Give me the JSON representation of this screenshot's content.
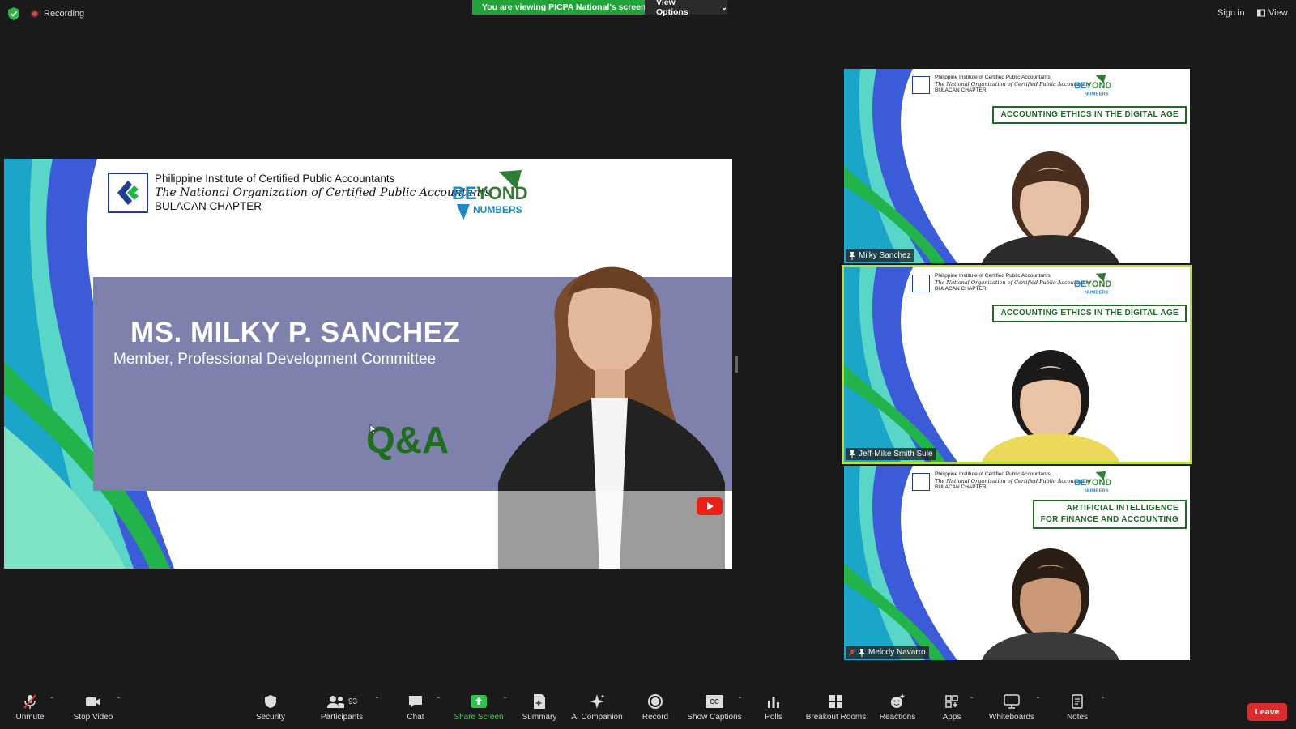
{
  "topbar": {
    "recording_label": "Recording",
    "viewing_banner": "You are viewing PICPA National's screen",
    "view_options_label": "View Options",
    "sign_in_label": "Sign in",
    "view_label": "View"
  },
  "slide": {
    "org_line1": "Philippine Institute of Certified Public Accountants",
    "org_line2": "The National Organization of Certified Public Accountants",
    "org_line3": "BULACAN CHAPTER",
    "speaker_name": "MS. MILKY P. SANCHEZ",
    "speaker_role": "Member, Professional Development Committee",
    "qa_label": "Q&A"
  },
  "tiles": [
    {
      "name": "Milky Sanchez",
      "title_lines": [
        "ACCOUNTING ETHICS IN THE DIGITAL AGE"
      ],
      "org_lines": [
        "Philippine Institute of Certified Public Accountants",
        "The National Organization of Certified Public Accountants",
        "BULACAN CHAPTER"
      ],
      "active": false,
      "muted": false
    },
    {
      "name": "Jeff-Mike Smith Sule",
      "title_lines": [
        "ACCOUNTING ETHICS IN THE DIGITAL AGE"
      ],
      "org_lines": [
        "Philippine Institute of Certified Public Accountants",
        "The National Organization of Certified Public Accountants",
        "BULACAN CHAPTER"
      ],
      "active": true,
      "muted": false
    },
    {
      "name": "Melody Navarro",
      "title_lines": [
        "ARTIFICIAL INTELLIGENCE",
        "FOR FINANCE AND ACCOUNTING"
      ],
      "org_lines": [
        "Philippine Institute of Certified Public Accountants",
        "The National Organization of Certified Public Accountants",
        "BULACAN CHAPTER"
      ],
      "active": false,
      "muted": true
    }
  ],
  "toolbar": {
    "unmute": "Unmute",
    "stop_video": "Stop Video",
    "security": "Security",
    "participants": "Participants",
    "participants_count": "93",
    "chat": "Chat",
    "share_screen": "Share Screen",
    "summary": "Summary",
    "ai_companion": "AI Companion",
    "record": "Record",
    "show_captions": "Show Captions",
    "captions_icon_text": "CC",
    "polls": "Polls",
    "breakout_rooms": "Breakout Rooms",
    "reactions": "Reactions",
    "apps": "Apps",
    "whiteboards": "Whiteboards",
    "notes": "Notes",
    "leave": "Leave"
  },
  "colors": {
    "green_banner": "#22a33a",
    "leave_red": "#d92d2d",
    "active_outline": "#b8e03a",
    "slide_band": "#7f81ad",
    "qa_green": "#1f6b1f"
  },
  "icons": [
    "shield-icon",
    "microphone-muted-icon",
    "video-camera-icon",
    "security-shield-icon",
    "participants-icon",
    "chat-icon",
    "share-screen-icon",
    "summary-icon",
    "ai-companion-icon",
    "record-icon",
    "captions-icon",
    "polls-icon",
    "breakout-rooms-icon",
    "reactions-icon",
    "apps-icon",
    "whiteboard-icon",
    "notes-icon",
    "youtube-icon",
    "pin-icon"
  ]
}
